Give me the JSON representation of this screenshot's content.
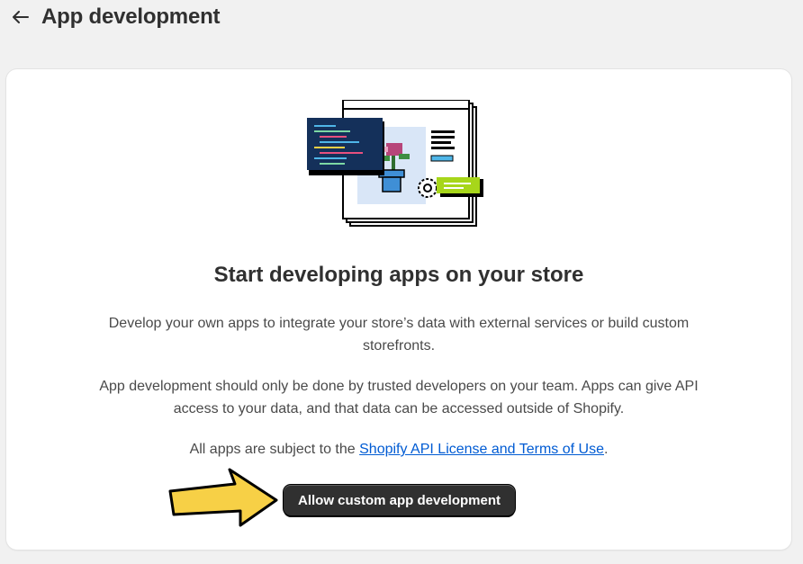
{
  "header": {
    "back_icon": "arrow-left-icon",
    "title": "App development"
  },
  "card": {
    "heading": "Start developing apps on your store",
    "paragraph1": "Develop your own apps to integrate your store’s data with external services or build custom storefronts.",
    "paragraph2": "App development should only be done by trusted developers on your team. Apps can give API access to your data, and that data can be accessed outside of Shopify.",
    "paragraph3_prefix": "All apps are subject to the ",
    "paragraph3_link": "Shopify API License and Terms of Use",
    "paragraph3_suffix": ".",
    "cta_label": "Allow custom app development"
  },
  "annotation": {
    "icon": "pointer-arrow-icon",
    "color": "#f7d046"
  },
  "colors": {
    "background": "#f1f1f1",
    "card": "#ffffff",
    "primary_button": "#303030",
    "link": "#005bd3"
  }
}
